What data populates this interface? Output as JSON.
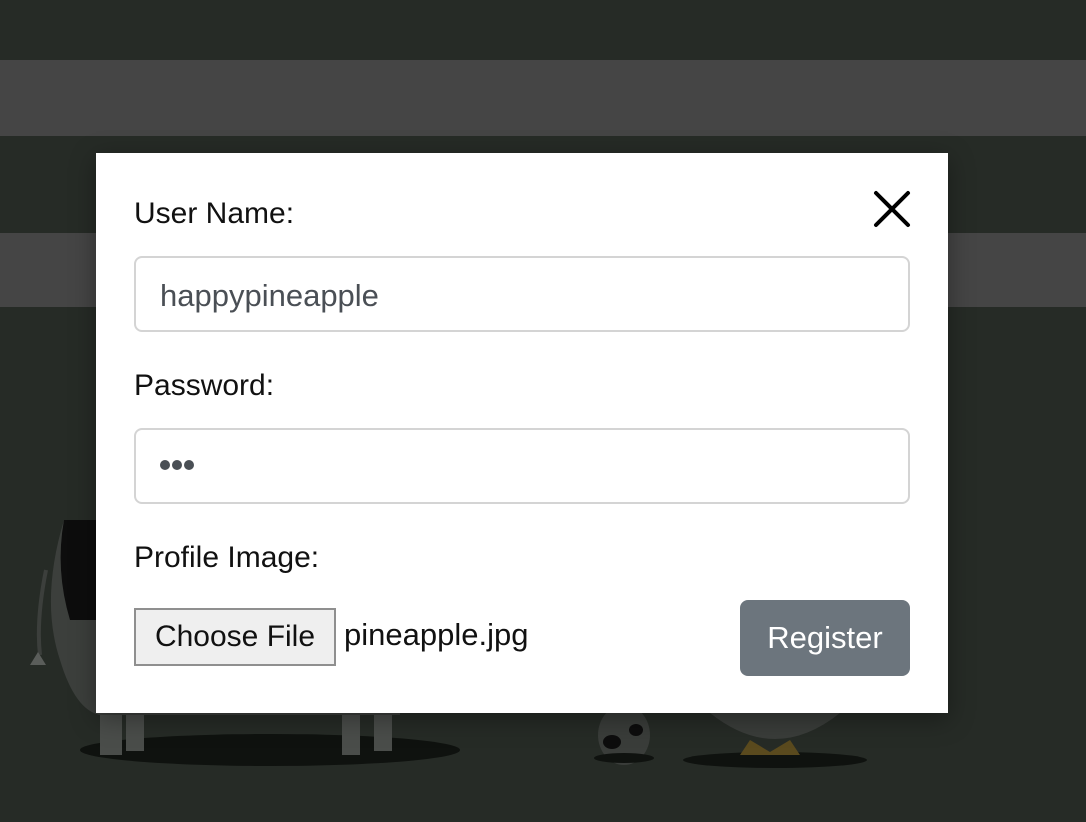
{
  "form": {
    "username_label": "User Name:",
    "username_value": "happypineapple",
    "password_label": "Password:",
    "password_dot_count": 3,
    "profile_image_label": "Profile Image:",
    "choose_file_label": "Choose File",
    "selected_file_name": "pineapple.jpg",
    "register_label": "Register"
  },
  "icons": {
    "close": "close-icon"
  },
  "colors": {
    "page_background": "#262b26",
    "background_band": "#454545",
    "modal_background": "#ffffff",
    "register_button": "#6c757d",
    "input_border": "#d4d4d4"
  }
}
